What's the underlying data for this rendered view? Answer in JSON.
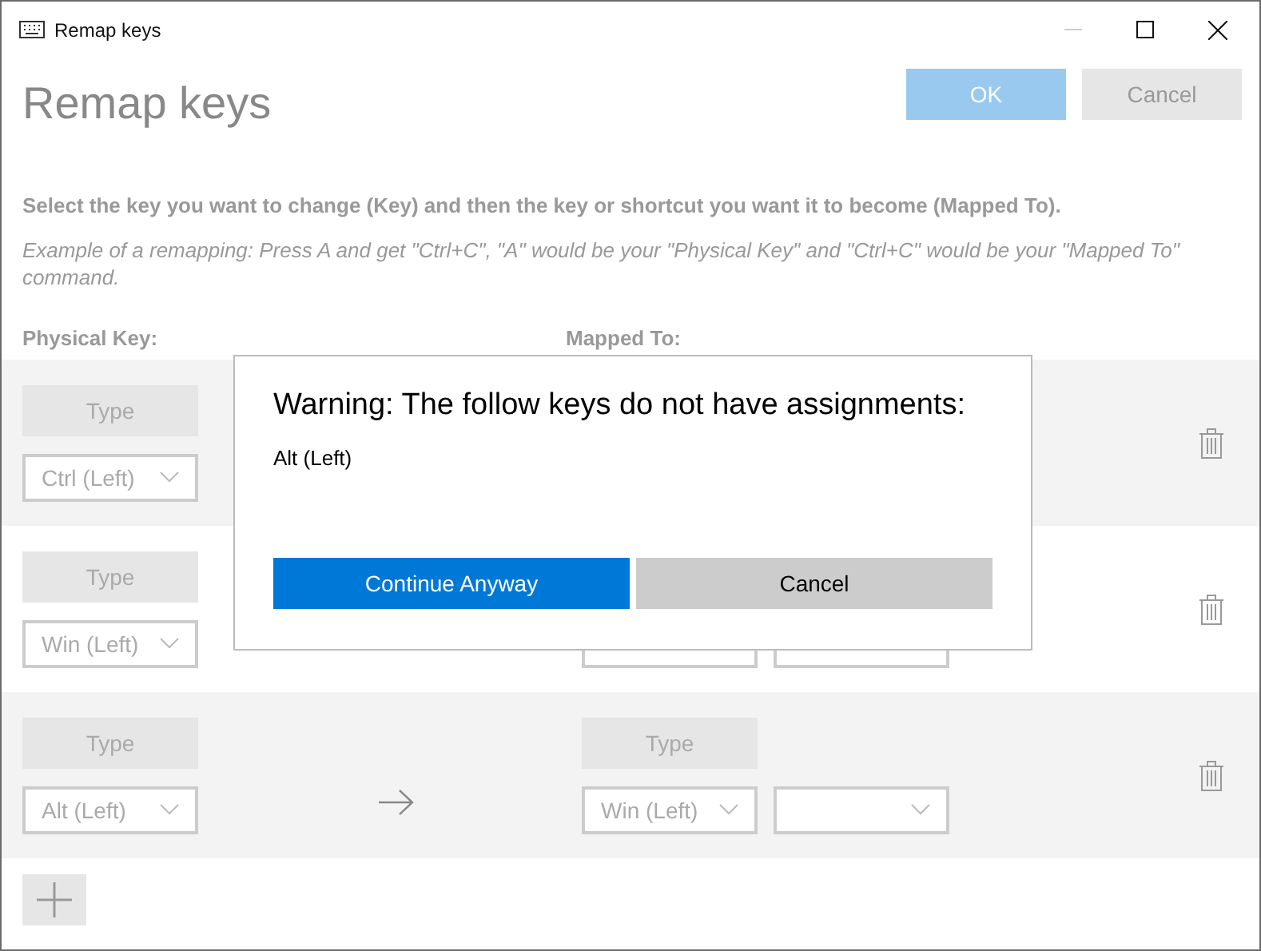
{
  "window": {
    "title": "Remap keys"
  },
  "header": {
    "title": "Remap keys",
    "ok": {
      "label": "OK",
      "disabled": true
    },
    "cancel": {
      "label": "Cancel",
      "disabled": true
    }
  },
  "instructions": "Select the key you want to change (Key) and then the key or shortcut you want it to become (Mapped To).",
  "example": "Example of a remapping: Press A and get \"Ctrl+C\", \"A\" would be your \"Physical Key\" and \"Ctrl+C\" would be your \"Mapped To\" command.",
  "columns": {
    "physical": "Physical Key:",
    "mapped": "Mapped To:"
  },
  "rows": [
    {
      "type_button": "Type",
      "key": "Ctrl (Left)",
      "disabled": true
    },
    {
      "type_button": "Type",
      "key": "Win (Left)",
      "disabled": true
    },
    {
      "type_button": "Type",
      "key": "Alt (Left)",
      "mapped_type_button": "Type",
      "mapped_key": "Win (Left)",
      "disabled": true
    }
  ],
  "dialog": {
    "title": "Warning: The follow keys do not have assignments:",
    "keys": [
      "Alt (Left)"
    ],
    "primary": "Continue Anyway",
    "secondary": "Cancel"
  }
}
